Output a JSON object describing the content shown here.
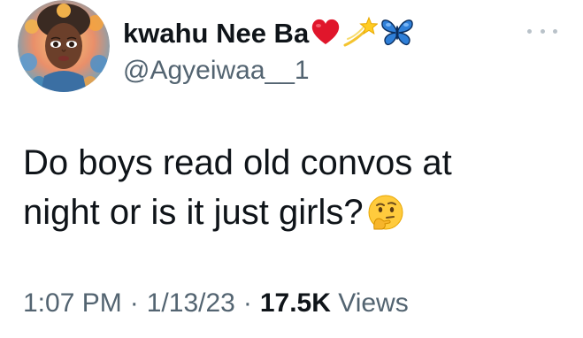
{
  "user": {
    "display_name": "kwahu Nee Ba",
    "name_emojis": [
      "heart-emoji",
      "dizzy-star-emoji",
      "butterfly-emoji"
    ],
    "handle": "@Agyeiwaa__1",
    "avatar": "avatar-illustrated-woman"
  },
  "tweet": {
    "text_line_1": "Do boys read old convos at",
    "text_line_2": "night or is it just girls?",
    "trailing_emoji": "thinking-face-emoji"
  },
  "meta": {
    "time": "1:07 PM",
    "separator": "·",
    "date": "1/13/23",
    "views_count": "17.5K",
    "views_label": "Views"
  },
  "icons": {
    "more": "more-options-icon"
  },
  "colors": {
    "primary_text": "#0f1419",
    "secondary_text": "#536471",
    "background": "#ffffff"
  }
}
